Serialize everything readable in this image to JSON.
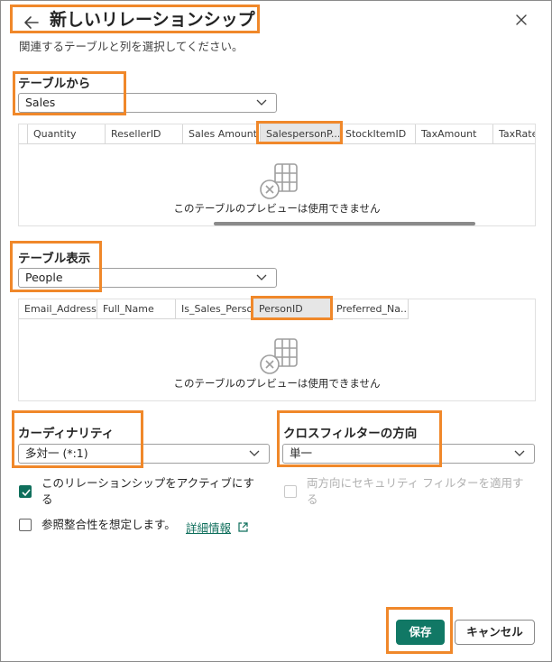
{
  "dialog": {
    "title": "新しいリレーションシップ",
    "subtitle": "関連するテーブルと列を選択してください。"
  },
  "from_table": {
    "label": "テーブルから",
    "selected": "Sales",
    "columns": [
      "Quantity",
      "ResellerID",
      "Sales Amount",
      "SalespersonP...",
      "StockItemID",
      "TaxAmount",
      "TaxRate"
    ],
    "selected_column": "SalespersonP...",
    "empty_text": "このテーブルのプレビューは使用できません"
  },
  "to_table": {
    "label": "テーブル表示",
    "selected": "People",
    "columns": [
      "Email_Address",
      "Full_Name",
      "Is_Sales_Person",
      "PersonID",
      "Preferred_Na..."
    ],
    "selected_column": "PersonID",
    "empty_text": "このテーブルのプレビューは使用できません"
  },
  "cardinality": {
    "label": "カーディナリティ",
    "selected": "多対一 (*:1)"
  },
  "cross_filter": {
    "label": "クロスフィルターの方向",
    "selected": "単一"
  },
  "options": {
    "active_line1": "このリレーションシップをアクティブにす",
    "active_line2": "る",
    "active_checked": true,
    "security_line1": "両方向にセキュリティ フィルターを適用す",
    "security_line2": "る",
    "security_checked": false,
    "referential_integrity": "参照整合性を想定します。",
    "referential_checked": false,
    "learn_more": "詳細情報"
  },
  "footer": {
    "save": "保存",
    "cancel": "キャンセル"
  },
  "colors": {
    "accent": "#117865",
    "highlight": "#f0882a"
  }
}
